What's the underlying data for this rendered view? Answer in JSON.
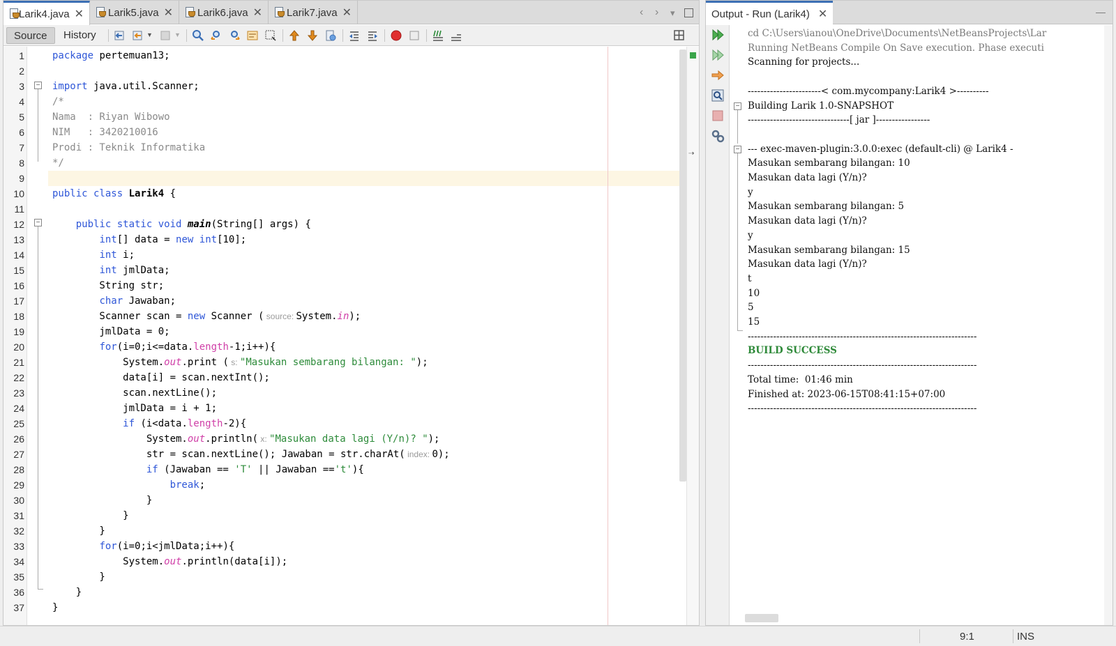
{
  "editor": {
    "tabs": [
      {
        "label": "Larik4.java",
        "active": true
      },
      {
        "label": "Larik5.java",
        "active": false
      },
      {
        "label": "Larik6.java",
        "active": false
      },
      {
        "label": "Larik7.java",
        "active": false
      }
    ],
    "toolbar": {
      "source_label": "Source",
      "history_label": "History"
    },
    "lines": [
      {
        "n": "1",
        "html": "<span class='kw'>package</span> pertemuan13;"
      },
      {
        "n": "2",
        "html": ""
      },
      {
        "n": "3",
        "html": "<span class='kw'>import</span> java.util.Scanner;"
      },
      {
        "n": "4",
        "html": "<span class='cm'>/*</span>"
      },
      {
        "n": "5",
        "html": "<span class='cm'>Nama  : Riyan Wibowo</span>"
      },
      {
        "n": "6",
        "html": "<span class='cm'>NIM   : 3420210016</span>"
      },
      {
        "n": "7",
        "html": "<span class='cm'>Prodi : Teknik Informatika</span>"
      },
      {
        "n": "8",
        "html": "<span class='cm'>*/</span>"
      },
      {
        "n": "9",
        "html": "",
        "highlight": true
      },
      {
        "n": "10",
        "html": "<span class='kw'>public class</span> <span class='cls'>Larik4</span> {"
      },
      {
        "n": "11",
        "html": ""
      },
      {
        "n": "12",
        "html": "    <span class='kw'>public static void</span> <span class='mth'>main</span>(String[] args) {"
      },
      {
        "n": "13",
        "html": "        <span class='kw'>int</span>[] data = <span class='kw'>new</span> <span class='kw'>int</span>[10];"
      },
      {
        "n": "14",
        "html": "        <span class='kw'>int</span> i;"
      },
      {
        "n": "15",
        "html": "        <span class='kw'>int</span> jmlData;"
      },
      {
        "n": "16",
        "html": "        String str;"
      },
      {
        "n": "17",
        "html": "        <span class='kw'>char</span> Jawaban;"
      },
      {
        "n": "18",
        "html": "        Scanner scan = <span class='kw'>new</span> Scanner (<span class='prm'> source: </span>System.<span class='fld'>in</span>);"
      },
      {
        "n": "19",
        "html": "        jmlData = 0;"
      },
      {
        "n": "20",
        "html": "        <span class='kw'>for</span>(i=0;i&lt;=data.<span class='fld' style='font-style:normal'>length</span>-1;i++){"
      },
      {
        "n": "21",
        "html": "            System.<span class='fld'>out</span>.print (<span class='prm'> s: </span><span class='str'>\"Masukan sembarang bilangan: \"</span>);"
      },
      {
        "n": "22",
        "html": "            data[i] = scan.nextInt();"
      },
      {
        "n": "23",
        "html": "            scan.nextLine();"
      },
      {
        "n": "24",
        "html": "            jmlData = i + 1;"
      },
      {
        "n": "25",
        "html": "            <span class='kw'>if</span> (i&lt;data.<span class='fld' style='font-style:normal'>length</span>-2){"
      },
      {
        "n": "26",
        "html": "                System.<span class='fld'>out</span>.println(<span class='prm'> x: </span><span class='str'>\"Masukan data lagi (Y/n)? \"</span>);"
      },
      {
        "n": "27",
        "html": "                str = scan.nextLine(); Jawaban = str.charAt(<span class='prm'> index: </span>0);"
      },
      {
        "n": "28",
        "html": "                <span class='kw'>if</span> (Jawaban == <span class='str'>'T'</span> || Jawaban ==<span class='str'>'t'</span>){"
      },
      {
        "n": "29",
        "html": "                    <span class='kw'>break</span>;"
      },
      {
        "n": "30",
        "html": "                }"
      },
      {
        "n": "31",
        "html": "            }"
      },
      {
        "n": "32",
        "html": "        }"
      },
      {
        "n": "33",
        "html": "        <span class='kw'>for</span>(i=0;i&lt;jmlData;i++){"
      },
      {
        "n": "34",
        "html": "            System.<span class='fld'>out</span>.println(data[i]);"
      },
      {
        "n": "35",
        "html": "        }"
      },
      {
        "n": "36",
        "html": "    }"
      },
      {
        "n": "37",
        "html": "}"
      }
    ]
  },
  "output": {
    "tab_label": "Output - Run (Larik4)",
    "lines": [
      {
        "text": "cd C:\\Users\\ianou\\OneDrive\\Documents\\NetBeansProjects\\Lar",
        "style": "gray"
      },
      {
        "text": "Running NetBeans Compile On Save execution. Phase executi",
        "style": "gray"
      },
      {
        "text": "Scanning for projects...",
        "style": ""
      },
      {
        "text": "",
        "style": ""
      },
      {
        "text": "-----------------------< com.mycompany:Larik4 >----------",
        "style": ""
      },
      {
        "text": "Building Larik 1.0-SNAPSHOT",
        "style": ""
      },
      {
        "text": "--------------------------------[ jar ]-----------------",
        "style": ""
      },
      {
        "text": "",
        "style": ""
      },
      {
        "text": "--- exec-maven-plugin:3.0.0:exec (default-cli) @ Larik4 -",
        "style": ""
      },
      {
        "text": "Masukan sembarang bilangan: 10",
        "style": ""
      },
      {
        "text": "Masukan data lagi (Y/n)?",
        "style": ""
      },
      {
        "text": "y",
        "style": ""
      },
      {
        "text": "Masukan sembarang bilangan: 5",
        "style": ""
      },
      {
        "text": "Masukan data lagi (Y/n)?",
        "style": ""
      },
      {
        "text": "y",
        "style": ""
      },
      {
        "text": "Masukan sembarang bilangan: 15",
        "style": ""
      },
      {
        "text": "Masukan data lagi (Y/n)?",
        "style": ""
      },
      {
        "text": "t",
        "style": ""
      },
      {
        "text": "10",
        "style": ""
      },
      {
        "text": "5",
        "style": ""
      },
      {
        "text": "15",
        "style": ""
      },
      {
        "text": "------------------------------------------------------------------------",
        "style": ""
      },
      {
        "text": "BUILD SUCCESS",
        "style": "ok"
      },
      {
        "text": "------------------------------------------------------------------------",
        "style": ""
      },
      {
        "text": "Total time:  01:46 min",
        "style": ""
      },
      {
        "text": "Finished at: 2023-06-15T08:41:15+07:00",
        "style": ""
      },
      {
        "text": "------------------------------------------------------------------------",
        "style": ""
      }
    ]
  },
  "statusbar": {
    "position": "9:1",
    "mode": "INS"
  },
  "colors": {
    "keyword": "#2f57d8",
    "comment": "#8a8a8a",
    "string": "#2d8b3a",
    "field": "#d040a8",
    "active_tab_border": "#3c6fb4",
    "current_line": "#fdf6e3",
    "build_success": "#2f8a3a"
  }
}
